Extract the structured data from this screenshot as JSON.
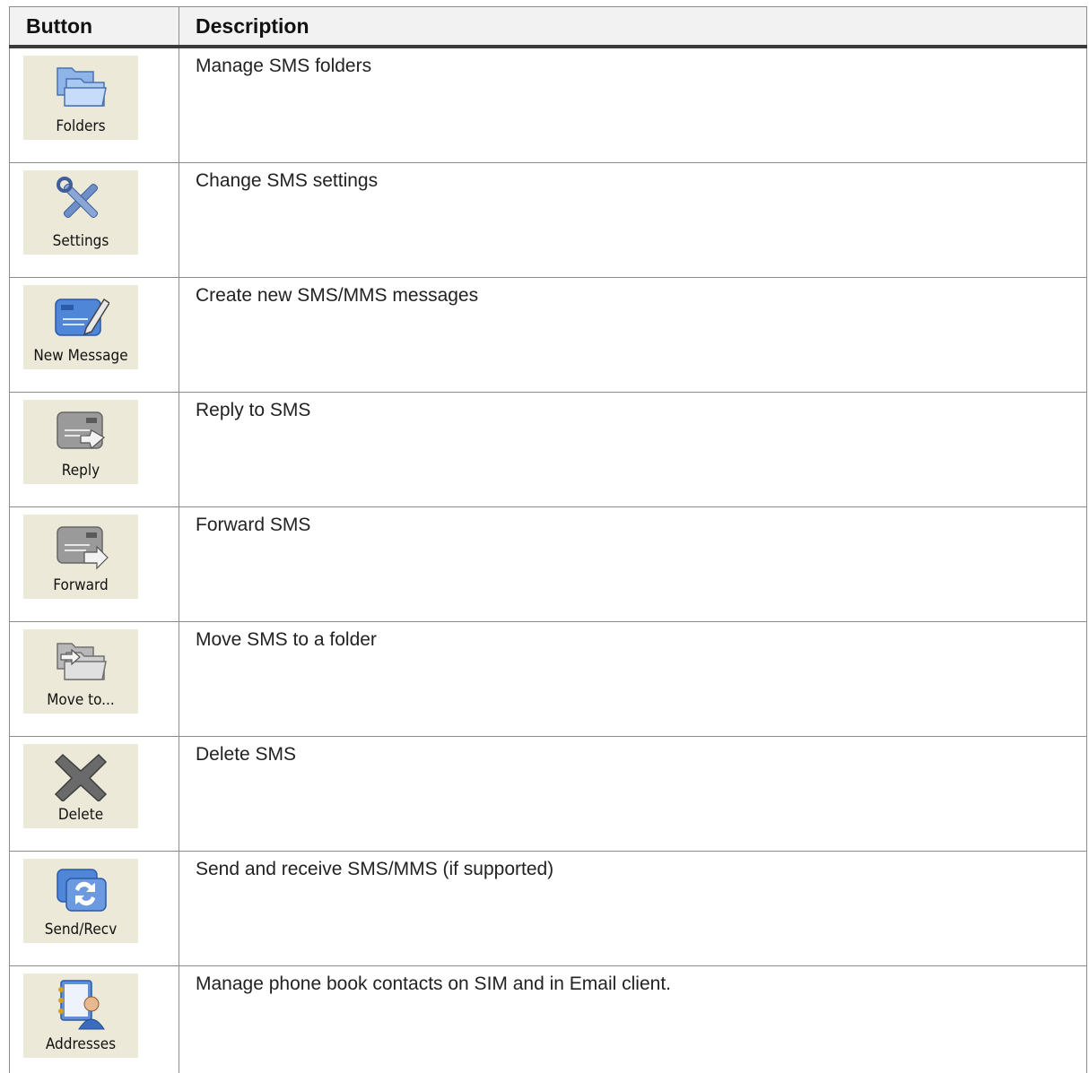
{
  "header": {
    "col_button": "Button",
    "col_description": "Description"
  },
  "rows": [
    {
      "icon": "folders-icon",
      "label": "Folders",
      "description": "Manage SMS folders"
    },
    {
      "icon": "settings-tools-icon",
      "label": "Settings",
      "description": "Change SMS settings"
    },
    {
      "icon": "new-message-icon",
      "label": "New Message",
      "description": "Create new SMS/MMS messages"
    },
    {
      "icon": "reply-icon",
      "label": "Reply",
      "description": "Reply to SMS"
    },
    {
      "icon": "forward-icon",
      "label": "Forward",
      "description": "Forward SMS"
    },
    {
      "icon": "move-to-folder-icon",
      "label": "Move to...",
      "description": "Move SMS to a folder"
    },
    {
      "icon": "delete-x-icon",
      "label": "Delete",
      "description": "Delete SMS"
    },
    {
      "icon": "send-receive-icon",
      "label": "Send/Recv",
      "description": "Send and receive SMS/MMS (if supported)"
    },
    {
      "icon": "address-book-icon",
      "label": "Addresses",
      "description": "Manage phone book contacts on SIM and in Email client."
    }
  ]
}
